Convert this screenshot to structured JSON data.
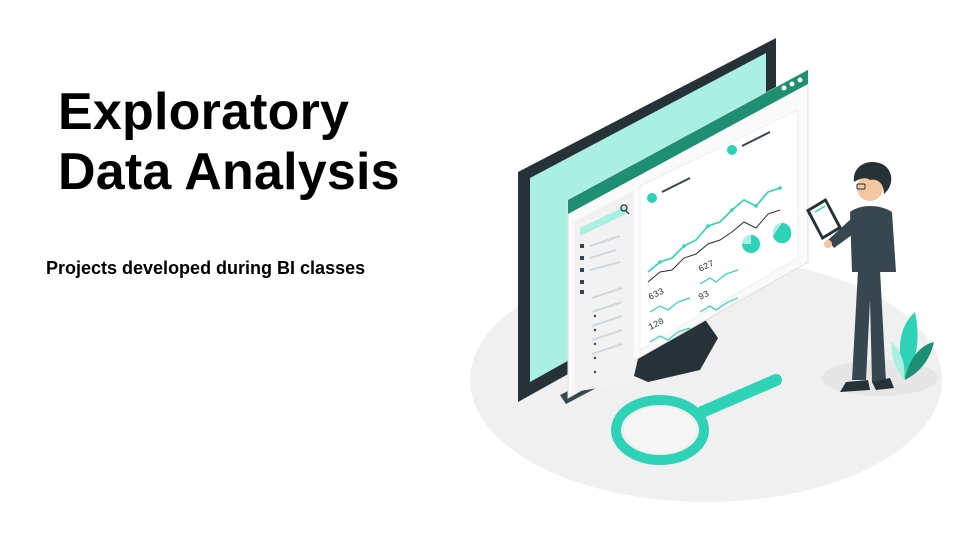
{
  "slide": {
    "title_line1": "Exploratory",
    "title_line2": "Data Analysis",
    "subtitle": "Projects developed during BI classes"
  },
  "illustration": {
    "stats": [
      "627",
      "633",
      "93",
      "120"
    ],
    "colors": {
      "accent": "#2ed3b7",
      "accent_light": "#a9f0e3",
      "dark": "#263238",
      "window_bar": "#1e8f72",
      "ground": "#f0f0f0"
    },
    "icons": [
      "search-icon",
      "magnifier-icon",
      "clipboard-icon",
      "plant-icon",
      "monitor-icon"
    ]
  }
}
